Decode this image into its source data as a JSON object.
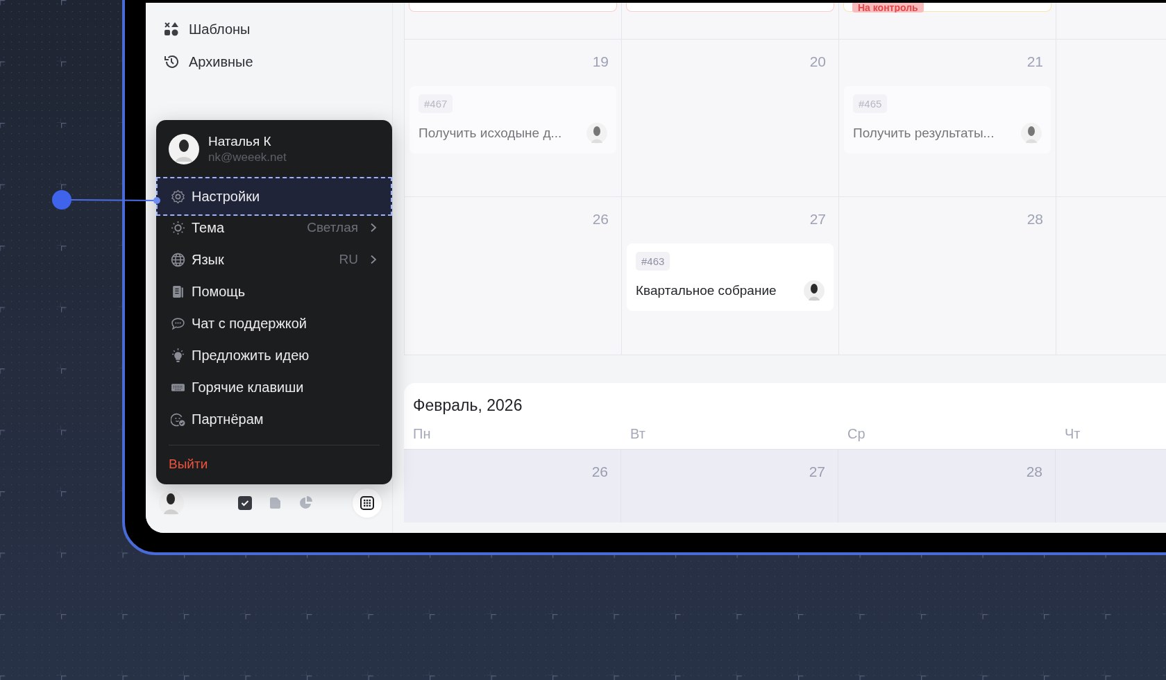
{
  "sidebar": {
    "items": [
      {
        "label": "Шаблоны"
      },
      {
        "label": "Архивные"
      }
    ]
  },
  "user_menu": {
    "name": "Наталья К",
    "email": "nk@weeek.net",
    "items": [
      {
        "label": "Настройки",
        "selected": true
      },
      {
        "label": "Тема",
        "value": "Светлая",
        "selected": false
      },
      {
        "label": "Язык",
        "value": "RU",
        "selected": false
      },
      {
        "label": "Помощь",
        "selected": false
      },
      {
        "label": "Чат с поддержкой",
        "selected": false
      },
      {
        "label": "Предложить идею",
        "selected": false
      },
      {
        "label": "Горячие клавиши",
        "selected": false
      },
      {
        "label": "Партнёрам",
        "selected": false
      }
    ],
    "logout": "Выйти"
  },
  "bottom_bar": {
    "tabs": [
      {
        "selected": true
      },
      {
        "selected": false
      },
      {
        "selected": false
      }
    ]
  },
  "calendar": {
    "top_row": [
      {
        "color": "#f6cfcf"
      },
      {
        "color": "#f6cfcf"
      },
      {
        "color": "#f3e9b0",
        "badge": "На контроль"
      }
    ],
    "weeks": [
      {
        "days": [
          {
            "day": "19",
            "tasks": [
              {
                "number": "#467",
                "title": "Получить исходыне д...",
                "faded": true
              }
            ]
          },
          {
            "day": "20"
          },
          {
            "day": "21",
            "tasks": [
              {
                "number": "#465",
                "title": "Получить результаты...",
                "faded": true
              }
            ]
          }
        ]
      },
      {
        "days": [
          {
            "day": "26"
          },
          {
            "day": "27",
            "tasks": [
              {
                "number": "#463",
                "title": "Квартальное собрание",
                "faded": false
              }
            ]
          },
          {
            "day": "28"
          }
        ]
      }
    ]
  },
  "february": {
    "title": "Февраль, 2026",
    "weekdays": [
      "Пн",
      "Вт",
      "Ср",
      "Чт"
    ],
    "days": [
      "26",
      "27",
      "28"
    ]
  }
}
